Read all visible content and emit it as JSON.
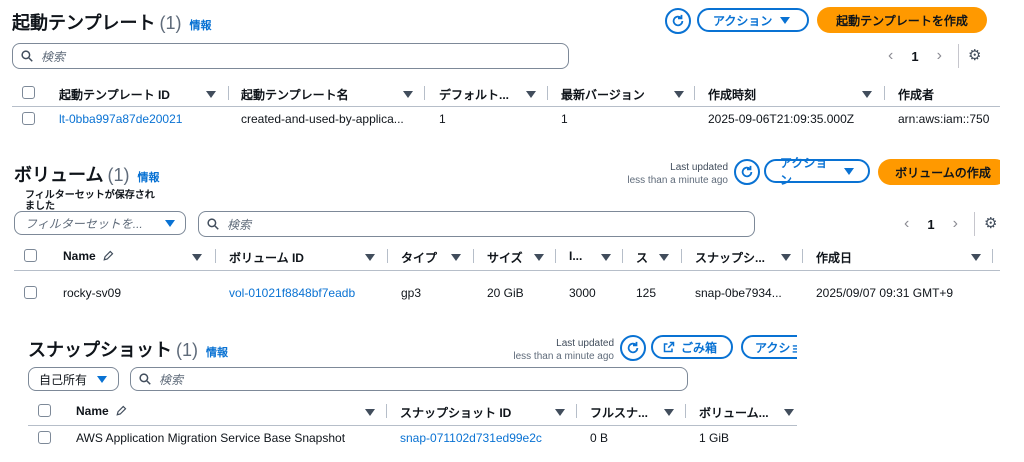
{
  "launch_templates": {
    "title": "起動テンプレート",
    "count": "(1)",
    "info": "情報",
    "actions_label": "アクション",
    "create_label": "起動テンプレートを作成",
    "search_placeholder": "検索",
    "page": "1",
    "columns": [
      "起動テンプレート ID",
      "起動テンプレート名",
      "デフォルト...",
      "最新バージョン",
      "作成時刻",
      "作成者"
    ],
    "rows": [
      [
        "lt-0bba997a87de20021",
        "created-and-used-by-applica...",
        "1",
        "1",
        "2025-09-06T21:09:35.000Z",
        "arn:aws:iam::750"
      ]
    ]
  },
  "volumes": {
    "title": "ボリューム",
    "count": "(1)",
    "info": "情報",
    "last_updated": "Last updated",
    "last_updated_time": "less than a minute ago",
    "actions_label": "アクション",
    "create_label": "ボリュームの作成",
    "saved_filter_label": "フィルターセットが保存されました",
    "saved_filter_placeholder": "フィルターセットを...",
    "search_placeholder": "検索",
    "page": "1",
    "columns": [
      "Name",
      "ボリューム ID",
      "タイプ",
      "サイズ",
      "I...",
      "ス",
      "スナップシ...",
      "作成日"
    ],
    "rows": [
      [
        "rocky-sv09",
        "vol-01021f8848bf7eadb",
        "gp3",
        "20 GiB",
        "3000",
        "125",
        "snap-0be7934...",
        "2025/09/07 09:31 GMT+9"
      ]
    ]
  },
  "snapshots": {
    "title": "スナップショット",
    "count": "(1)",
    "info": "情報",
    "last_updated": "Last updated",
    "last_updated_time": "less than a minute ago",
    "trash_label": "ごみ箱",
    "actions_label": "アクショ",
    "owner_filter": "自己所有",
    "search_placeholder": "検索",
    "columns": [
      "Name",
      "スナップショット ID",
      "フルスナ...",
      "ボリューム..."
    ],
    "rows": [
      [
        "AWS Application Migration Service Base Snapshot",
        "snap-071102d731ed99e2c",
        "0 B",
        "1 GiB"
      ]
    ]
  },
  "icons": {
    "refresh": "refresh-icon",
    "search": "search-icon",
    "gear": "gear-icon",
    "edit": "pencil-icon",
    "external": "external-link-icon",
    "caret": "caret-down-icon"
  },
  "colors": {
    "primary": "#ff9900",
    "link": "#0972d3",
    "text": "#0f141a",
    "muted": "#5f6b7a"
  }
}
